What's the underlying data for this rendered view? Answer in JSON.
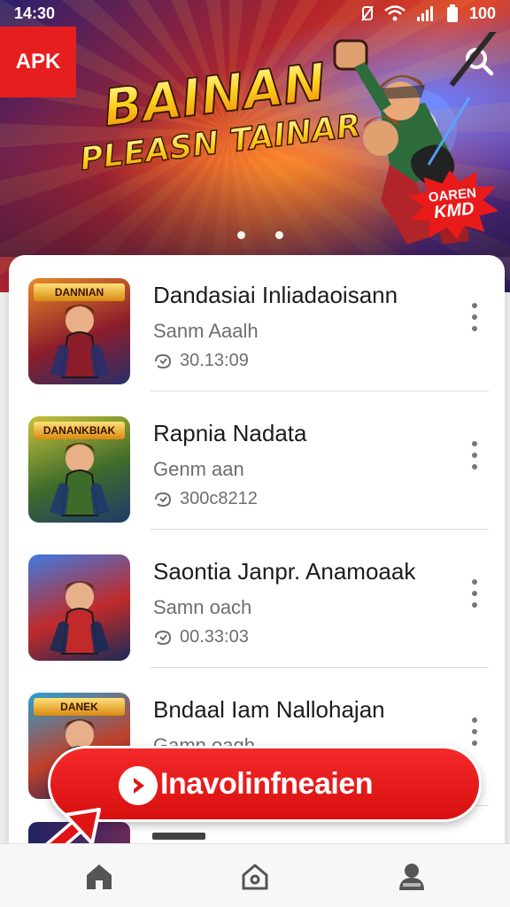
{
  "status_bar": {
    "time": "14:30",
    "battery": "100"
  },
  "banner": {
    "tag": "APK",
    "title_line1": "BAINAN",
    "title_line2": "PLEASN TAINAR",
    "burst_line1": "OAREN",
    "burst_line2": "KMD",
    "carousel_pages": 2,
    "carousel_active": 1
  },
  "apps": [
    {
      "title": "Dandasiai Inliadaoisann",
      "subtitle": "Sanm Aaalh",
      "meta": "30.13:09",
      "thumb_label": "DANNIAN",
      "thumb_colors": [
        "#e8892a",
        "#8b1d2a",
        "#2a2f6a"
      ]
    },
    {
      "title": "Rapnia Nadata",
      "subtitle": "Genm aan",
      "meta": "300c8212",
      "thumb_label": "DANANKBIAK",
      "thumb_colors": [
        "#c7c23a",
        "#3f6b2a",
        "#1f3a6a"
      ]
    },
    {
      "title": "Saontia Janpr. Anamoaak",
      "subtitle": "Samn oach",
      "meta": "00.33:03",
      "thumb_label": "",
      "thumb_colors": [
        "#3f7be0",
        "#c02a2a",
        "#1a2a55"
      ]
    },
    {
      "title": "Bndaal Iam Nallohajan",
      "subtitle": "Gamn oaqh",
      "meta": "",
      "thumb_label": "DANEK",
      "thumb_colors": [
        "#2aa0d0",
        "#c0402a",
        "#1a2455"
      ]
    }
  ],
  "fab": {
    "label": "Inavolinfneaien"
  },
  "nav": [
    "home-icon",
    "home-outline-icon",
    "profile-icon"
  ],
  "colors": {
    "accent": "#e61e1e",
    "card": "#ffffff",
    "text": "#1c1c1c",
    "muted": "#6e6e6e"
  }
}
